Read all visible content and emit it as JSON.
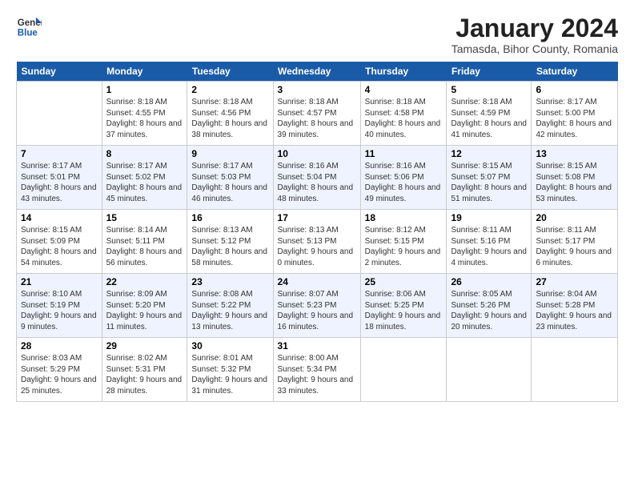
{
  "logo": {
    "line1": "General",
    "line2": "Blue"
  },
  "title": "January 2024",
  "subtitle": "Tamasda, Bihor County, Romania",
  "days": [
    "Sunday",
    "Monday",
    "Tuesday",
    "Wednesday",
    "Thursday",
    "Friday",
    "Saturday"
  ],
  "weeks": [
    [
      {
        "date": "",
        "data": null
      },
      {
        "date": "1",
        "data": {
          "sunrise": "8:18 AM",
          "sunset": "4:55 PM",
          "daylight": "8 hours and 37 minutes."
        }
      },
      {
        "date": "2",
        "data": {
          "sunrise": "8:18 AM",
          "sunset": "4:56 PM",
          "daylight": "8 hours and 38 minutes."
        }
      },
      {
        "date": "3",
        "data": {
          "sunrise": "8:18 AM",
          "sunset": "4:57 PM",
          "daylight": "8 hours and 39 minutes."
        }
      },
      {
        "date": "4",
        "data": {
          "sunrise": "8:18 AM",
          "sunset": "4:58 PM",
          "daylight": "8 hours and 40 minutes."
        }
      },
      {
        "date": "5",
        "data": {
          "sunrise": "8:18 AM",
          "sunset": "4:59 PM",
          "daylight": "8 hours and 41 minutes."
        }
      },
      {
        "date": "6",
        "data": {
          "sunrise": "8:17 AM",
          "sunset": "5:00 PM",
          "daylight": "8 hours and 42 minutes."
        }
      }
    ],
    [
      {
        "date": "7",
        "data": {
          "sunrise": "8:17 AM",
          "sunset": "5:01 PM",
          "daylight": "8 hours and 43 minutes."
        }
      },
      {
        "date": "8",
        "data": {
          "sunrise": "8:17 AM",
          "sunset": "5:02 PM",
          "daylight": "8 hours and 45 minutes."
        }
      },
      {
        "date": "9",
        "data": {
          "sunrise": "8:17 AM",
          "sunset": "5:03 PM",
          "daylight": "8 hours and 46 minutes."
        }
      },
      {
        "date": "10",
        "data": {
          "sunrise": "8:16 AM",
          "sunset": "5:04 PM",
          "daylight": "8 hours and 48 minutes."
        }
      },
      {
        "date": "11",
        "data": {
          "sunrise": "8:16 AM",
          "sunset": "5:06 PM",
          "daylight": "8 hours and 49 minutes."
        }
      },
      {
        "date": "12",
        "data": {
          "sunrise": "8:15 AM",
          "sunset": "5:07 PM",
          "daylight": "8 hours and 51 minutes."
        }
      },
      {
        "date": "13",
        "data": {
          "sunrise": "8:15 AM",
          "sunset": "5:08 PM",
          "daylight": "8 hours and 53 minutes."
        }
      }
    ],
    [
      {
        "date": "14",
        "data": {
          "sunrise": "8:15 AM",
          "sunset": "5:09 PM",
          "daylight": "8 hours and 54 minutes."
        }
      },
      {
        "date": "15",
        "data": {
          "sunrise": "8:14 AM",
          "sunset": "5:11 PM",
          "daylight": "8 hours and 56 minutes."
        }
      },
      {
        "date": "16",
        "data": {
          "sunrise": "8:13 AM",
          "sunset": "5:12 PM",
          "daylight": "8 hours and 58 minutes."
        }
      },
      {
        "date": "17",
        "data": {
          "sunrise": "8:13 AM",
          "sunset": "5:13 PM",
          "daylight": "9 hours and 0 minutes."
        }
      },
      {
        "date": "18",
        "data": {
          "sunrise": "8:12 AM",
          "sunset": "5:15 PM",
          "daylight": "9 hours and 2 minutes."
        }
      },
      {
        "date": "19",
        "data": {
          "sunrise": "8:11 AM",
          "sunset": "5:16 PM",
          "daylight": "9 hours and 4 minutes."
        }
      },
      {
        "date": "20",
        "data": {
          "sunrise": "8:11 AM",
          "sunset": "5:17 PM",
          "daylight": "9 hours and 6 minutes."
        }
      }
    ],
    [
      {
        "date": "21",
        "data": {
          "sunrise": "8:10 AM",
          "sunset": "5:19 PM",
          "daylight": "9 hours and 9 minutes."
        }
      },
      {
        "date": "22",
        "data": {
          "sunrise": "8:09 AM",
          "sunset": "5:20 PM",
          "daylight": "9 hours and 11 minutes."
        }
      },
      {
        "date": "23",
        "data": {
          "sunrise": "8:08 AM",
          "sunset": "5:22 PM",
          "daylight": "9 hours and 13 minutes."
        }
      },
      {
        "date": "24",
        "data": {
          "sunrise": "8:07 AM",
          "sunset": "5:23 PM",
          "daylight": "9 hours and 16 minutes."
        }
      },
      {
        "date": "25",
        "data": {
          "sunrise": "8:06 AM",
          "sunset": "5:25 PM",
          "daylight": "9 hours and 18 minutes."
        }
      },
      {
        "date": "26",
        "data": {
          "sunrise": "8:05 AM",
          "sunset": "5:26 PM",
          "daylight": "9 hours and 20 minutes."
        }
      },
      {
        "date": "27",
        "data": {
          "sunrise": "8:04 AM",
          "sunset": "5:28 PM",
          "daylight": "9 hours and 23 minutes."
        }
      }
    ],
    [
      {
        "date": "28",
        "data": {
          "sunrise": "8:03 AM",
          "sunset": "5:29 PM",
          "daylight": "9 hours and 25 minutes."
        }
      },
      {
        "date": "29",
        "data": {
          "sunrise": "8:02 AM",
          "sunset": "5:31 PM",
          "daylight": "9 hours and 28 minutes."
        }
      },
      {
        "date": "30",
        "data": {
          "sunrise": "8:01 AM",
          "sunset": "5:32 PM",
          "daylight": "9 hours and 31 minutes."
        }
      },
      {
        "date": "31",
        "data": {
          "sunrise": "8:00 AM",
          "sunset": "5:34 PM",
          "daylight": "9 hours and 33 minutes."
        }
      },
      {
        "date": "",
        "data": null
      },
      {
        "date": "",
        "data": null
      },
      {
        "date": "",
        "data": null
      }
    ]
  ]
}
